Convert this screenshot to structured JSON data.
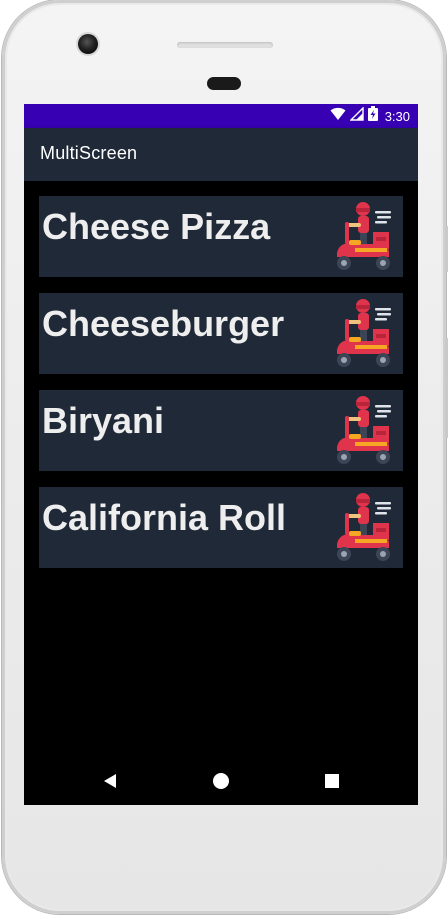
{
  "status_bar": {
    "time": "3:30",
    "wifi_icon": "wifi-icon",
    "signal_icon": "cell-signal-icon",
    "battery_icon": "battery-charging-icon"
  },
  "app_bar": {
    "title": "MultiScreen"
  },
  "list": {
    "items": [
      {
        "label": "Cheese Pizza",
        "icon": "delivery-scooter-icon"
      },
      {
        "label": "Cheeseburger",
        "icon": "delivery-scooter-icon"
      },
      {
        "label": "Biryani",
        "icon": "delivery-scooter-icon"
      },
      {
        "label": "California Roll",
        "icon": "delivery-scooter-icon"
      }
    ]
  },
  "nav_bar": {
    "back_icon": "back-triangle-icon",
    "home_icon": "home-circle-icon",
    "recents_icon": "recents-square-icon"
  },
  "colors": {
    "status_bar": "#3700b3",
    "app_bar": "#1f2937",
    "list_item_bg": "#1f2937",
    "item_text": "#eeeeee",
    "screen_bg": "#000000"
  }
}
